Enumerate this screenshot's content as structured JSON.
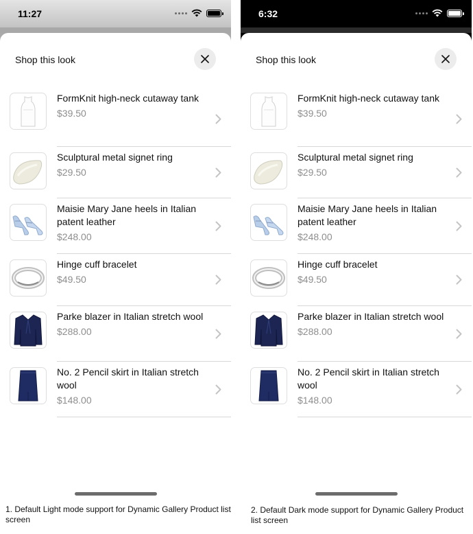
{
  "screens": [
    {
      "mode": "light",
      "status_time": "11:27",
      "sheet_title": "Shop this look",
      "caption": "1. Default Light mode support for Dynamic Gallery Product list screen"
    },
    {
      "mode": "dark",
      "status_time": "6:32",
      "sheet_title": "Shop this look",
      "caption": "2. Default Dark mode support for Dynamic Gallery Product list screen"
    }
  ],
  "products": [
    {
      "name": "FormKnit high-neck cutaway tank",
      "price": "$39.50",
      "image": "white-tank-icon"
    },
    {
      "name": "Sculptural metal signet ring",
      "price": "$29.50",
      "image": "ring-icon"
    },
    {
      "name": "Maisie Mary Jane heels in Italian patent leather",
      "price": "$248.00",
      "image": "heels-icon"
    },
    {
      "name": "Hinge cuff bracelet",
      "price": "$49.50",
      "image": "bracelet-icon"
    },
    {
      "name": "Parke blazer in Italian stretch wool",
      "price": "$288.00",
      "image": "blazer-icon"
    },
    {
      "name": "No. 2 Pencil skirt in Italian stretch wool",
      "price": "$148.00",
      "image": "skirt-icon"
    }
  ],
  "colors": {
    "sheet_background": "#ffffff",
    "price_text": "#8e8e8e",
    "divider": "#d7d7d7",
    "close_button_bg": "#ececec",
    "dark_status_bar": "#000000"
  }
}
